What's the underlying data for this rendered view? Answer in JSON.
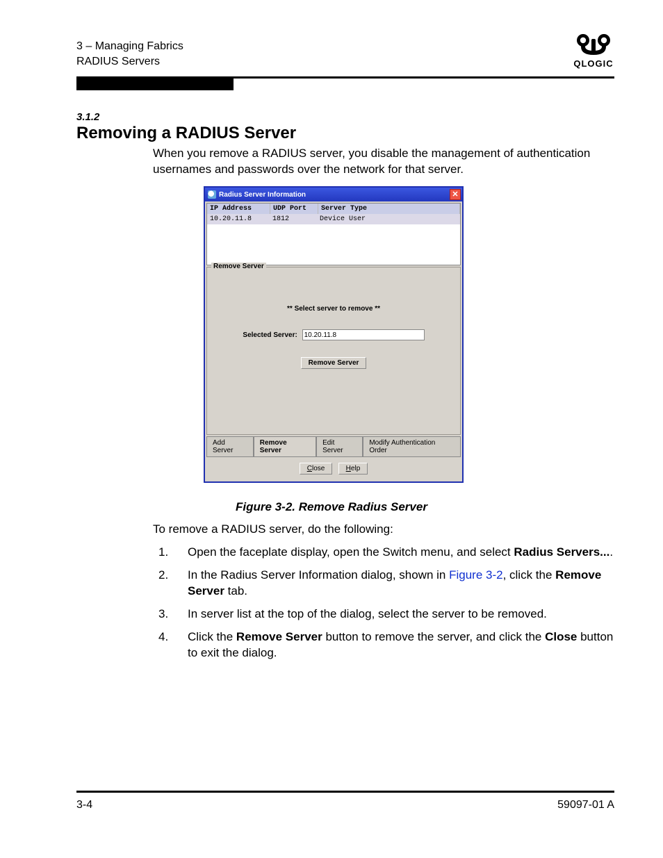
{
  "header": {
    "chapter_line": "3 – Managing Fabrics",
    "section_line": "RADIUS Servers",
    "brand": "QLOGIC"
  },
  "section": {
    "number": "3.1.2",
    "title": "Removing a RADIUS Server",
    "intro": "When you remove a RADIUS server, you disable the management of authentication usernames and passwords over the network for that server."
  },
  "dialog": {
    "title": "Radius Server Information",
    "columns": {
      "ip": "IP Address",
      "port": "UDP Port",
      "type": "Server Type"
    },
    "row": {
      "ip": "10.20.11.8",
      "port": "1812",
      "type": "Device  User"
    },
    "group_legend": "Remove Server",
    "prompt": "** Select server to remove **",
    "selected_label": "Selected Server:",
    "selected_value": "10.20.11.8",
    "remove_button": "Remove Server",
    "tabs": {
      "add": "Add Server",
      "remove": "Remove Server",
      "edit": "Edit Server",
      "modify": "Modify Authentication Order"
    },
    "close_btn_rest": "lose",
    "help_btn_rest": "elp"
  },
  "figure_caption": "Figure 3-2.  Remove Radius Server",
  "para2": "To remove a RADIUS server, do the following:",
  "steps": {
    "n1": "1.",
    "s1a": "Open the faceplate display, open the Switch menu, and select ",
    "s1b": "Radius Servers...",
    "s1c": ".",
    "n2": "2.",
    "s2a": "In the Radius Server Information dialog, shown in ",
    "s2link": "Figure 3-2",
    "s2b": ", click the ",
    "s2c": "Remove Server",
    "s2d": " tab.",
    "n3": "3.",
    "s3": "In server list at the top of the dialog, select the server to be removed.",
    "n4": "4.",
    "s4a": "Click the ",
    "s4b": "Remove Server",
    "s4c": " button to remove the server, and click the ",
    "s4d": "Close",
    "s4e": " button to exit the dialog."
  },
  "footer": {
    "left": "3-4",
    "right": "59097-01 A"
  }
}
